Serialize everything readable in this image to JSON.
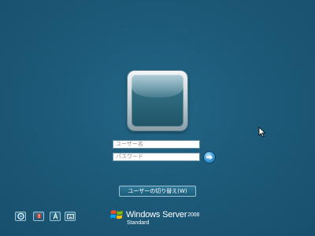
{
  "login": {
    "username_placeholder": "ユーザー名",
    "password_placeholder": "パスワード",
    "switch_user_label": "ユーザーの切り替え(W)",
    "submit_icon": "arrow-right-icon"
  },
  "toolbar": {
    "buttons": [
      {
        "icon": "ease-of-access-icon"
      },
      {
        "icon": "alert-icon"
      },
      {
        "icon": "language-icon"
      },
      {
        "icon": "keyboard-icon"
      }
    ]
  },
  "branding": {
    "product_name": "Windows Server",
    "year": "2008",
    "edition": "Standard",
    "logo_icon": "windows-flag-icon"
  },
  "colors": {
    "background": "#1d5a79",
    "accent_blue": "#3f9fd8"
  }
}
